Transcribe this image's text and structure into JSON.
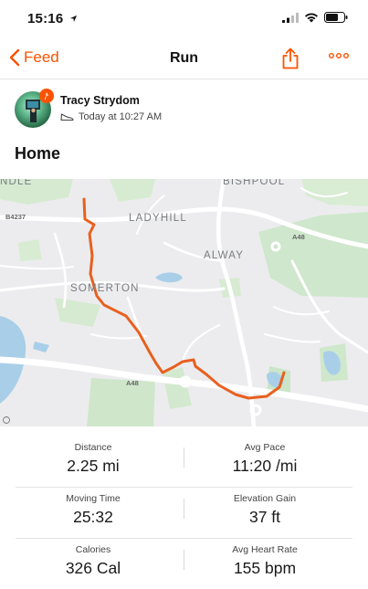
{
  "status_bar": {
    "time": "15:16"
  },
  "nav": {
    "back_label": "Feed",
    "title": "Run"
  },
  "athlete": {
    "name": "Tracy Strydom",
    "timestamp": "Today at 10:27 AM"
  },
  "activity": {
    "title": "Home"
  },
  "map": {
    "place_labels": [
      "LADYHILL",
      "ALWAY",
      "SOMERTON",
      "BISHPOOL",
      "NDLE"
    ],
    "road_labels": [
      "B4237",
      "A48",
      "A48"
    ],
    "route_color": "#e8601e"
  },
  "stats": [
    {
      "label": "Distance",
      "value": "2.25 mi"
    },
    {
      "label": "Avg Pace",
      "value": "11:20 /mi"
    },
    {
      "label": "Moving Time",
      "value": "25:32"
    },
    {
      "label": "Elevation Gain",
      "value": "37 ft"
    },
    {
      "label": "Calories",
      "value": "326 Cal"
    },
    {
      "label": "Avg Heart Rate",
      "value": "155 bpm"
    }
  ],
  "colors": {
    "accent": "#fc5200",
    "divider": "#e3e3e3"
  }
}
